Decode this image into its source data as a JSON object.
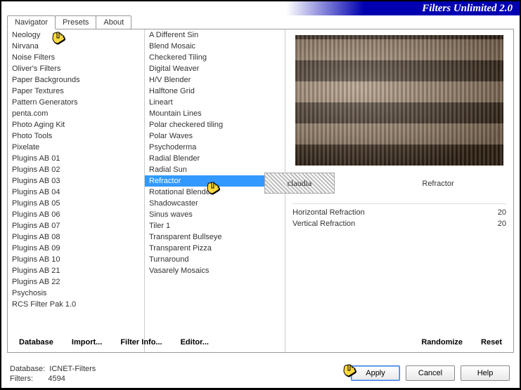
{
  "title": "Filters Unlimited 2.0",
  "tabs": {
    "navigator": "Navigator",
    "presets": "Presets",
    "about": "About"
  },
  "categories": [
    "Neology",
    "Nirvana",
    "Noise Filters",
    "Oliver's Filters",
    "Paper Backgrounds",
    "Paper Textures",
    "Pattern Generators",
    "penta.com",
    "Photo Aging Kit",
    "Photo Tools",
    "Pixelate",
    "Plugins AB 01",
    "Plugins AB 02",
    "Plugins AB 03",
    "Plugins AB 04",
    "Plugins AB 05",
    "Plugins AB 06",
    "Plugins AB 07",
    "Plugins AB 08",
    "Plugins AB 09",
    "Plugins AB 10",
    "Plugins AB 21",
    "Plugins AB 22",
    "Psychosis",
    "RCS Filter Pak 1.0"
  ],
  "filters": [
    "A Different Sin",
    "Blend Mosaic",
    "Checkered Tiling",
    "Digital Weaver",
    "H/V Blender",
    "Halftone Grid",
    "Lineart",
    "Mountain Lines",
    "Polar checkered tiling",
    "Polar Waves",
    "Psychoderma",
    "Radial Blender",
    "Radial Sun",
    "Refractor",
    "Rotational Blender",
    "Shadowcaster",
    "Sinus waves",
    "Tiler 1",
    "Transparent Bullseye",
    "Transparent Pizza",
    "Turnaround",
    "Vasarely Mosaics"
  ],
  "selected_filter_index": 13,
  "stamp": "claudia",
  "filter_name": "Refractor",
  "params": [
    {
      "label": "Horizontal Refraction",
      "value": "20"
    },
    {
      "label": "Vertical Refraction",
      "value": "20"
    }
  ],
  "bottom_buttons": {
    "database": "Database",
    "import": "Import...",
    "filter_info": "Filter Info...",
    "editor": "Editor...",
    "randomize": "Randomize",
    "reset": "Reset"
  },
  "status": {
    "db_label": "Database:",
    "db_value": "ICNET-Filters",
    "filters_label": "Filters:",
    "filters_value": "4594"
  },
  "main_buttons": {
    "apply": "Apply",
    "cancel": "Cancel",
    "help": "Help"
  }
}
